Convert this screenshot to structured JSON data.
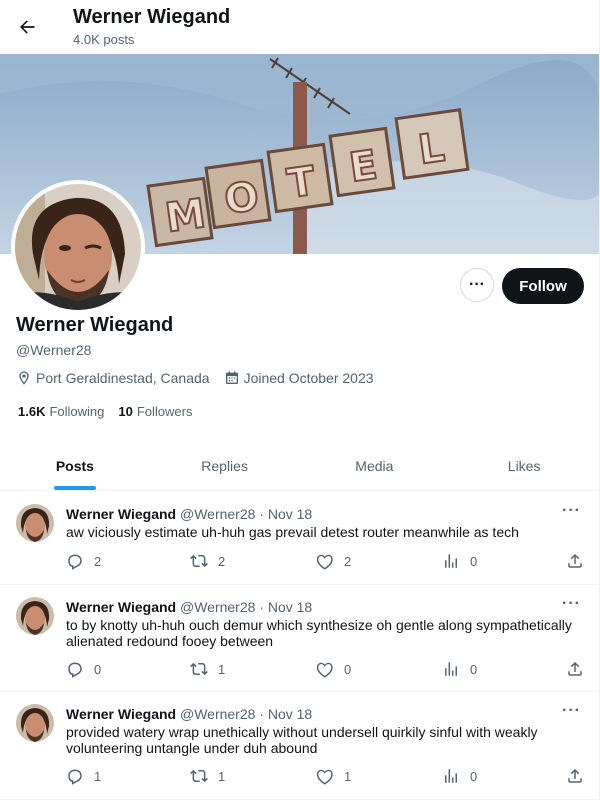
{
  "header": {
    "title": "Werner Wiegand",
    "post_count": "4.0K posts"
  },
  "banner": {
    "sign_text": "MOTEL"
  },
  "profile": {
    "name": "Werner Wiegand",
    "handle": "@Werner28",
    "location": "Port Geraldinestad, Canada",
    "joined": "Joined October 2023",
    "following_count": "1.6K",
    "following_label": "Following",
    "followers_count": "10",
    "followers_label": "Followers",
    "follow_label": "Follow",
    "more_label": "···"
  },
  "tabs": [
    {
      "label": "Posts",
      "active": true
    },
    {
      "label": "Replies",
      "active": false
    },
    {
      "label": "Media",
      "active": false
    },
    {
      "label": "Likes",
      "active": false
    }
  ],
  "posts": [
    {
      "name": "Werner Wiegand",
      "meta": "@Werner28 · Nov 18",
      "text": "aw viciously estimate uh-huh gas prevail detest router meanwhile as tech",
      "replies": "2",
      "reposts": "2",
      "likes": "2",
      "views": "0"
    },
    {
      "name": "Werner Wiegand",
      "meta": "@Werner28 · Nov 18",
      "text": "to by knotty uh-huh ouch demur which synthesize oh gentle along sympathetically alienated redound fooey between",
      "replies": "0",
      "reposts": "1",
      "likes": "0",
      "views": "0"
    },
    {
      "name": "Werner Wiegand",
      "meta": "@Werner28 · Nov 18",
      "text": "provided watery wrap unethically without undersell quirkily sinful with weakly volunteering untangle under duh abound",
      "replies": "1",
      "reposts": "1",
      "likes": "1",
      "views": "0"
    }
  ],
  "colors": {
    "accent": "#1d9bf0",
    "text_primary": "#0f1419",
    "text_secondary": "#536471",
    "border": "#eff3f4"
  }
}
